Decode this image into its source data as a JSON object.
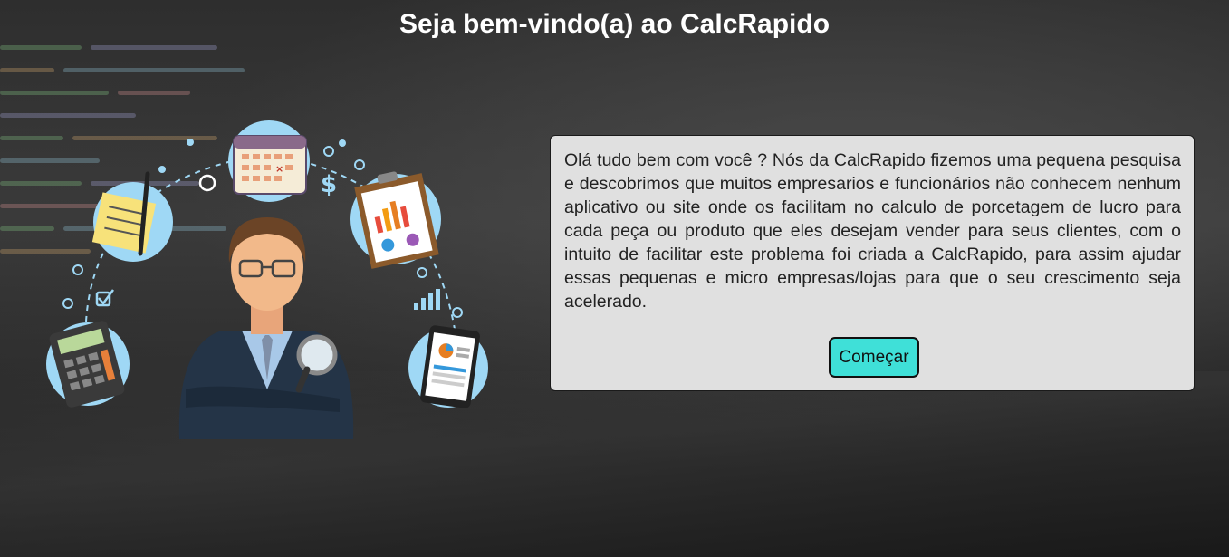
{
  "header": {
    "title": "Seja bem-vindo(a) ao CalcRapido"
  },
  "illustration": {
    "subject": "businessman-with-financial-icons",
    "icons": [
      "calendar-icon",
      "sticky-notes-icon",
      "calculator-icon",
      "clipboard-chart-icon",
      "smartphone-report-icon",
      "dollar-icon",
      "checkbox-icon",
      "bar-chart-icon",
      "magnifying-glass-icon",
      "pen-icon"
    ],
    "dollar_symbol": "$"
  },
  "intro_card": {
    "text": "Olá tudo bem com você ? Nós da CalcRapido fizemos uma pequena pesquisa e descobrimos que muitos empresarios e funcionários não conhecem nenhum aplicativo ou site onde os facilitam no calculo de porcetagem de lucro para cada peça ou produto que eles desejam vender para seus clientes, com o intuito de facilitar este problema foi criada a CalcRapido, para assim ajudar essas pequenas e micro empresas/lojas para que o seu crescimento seja acelerado.",
    "button_label": "Começar"
  },
  "colors": {
    "button_bg": "#3fe0d8",
    "card_bg": "#e0e0e0",
    "title_color": "#ffffff",
    "icon_circle": "#9fd8f5"
  }
}
